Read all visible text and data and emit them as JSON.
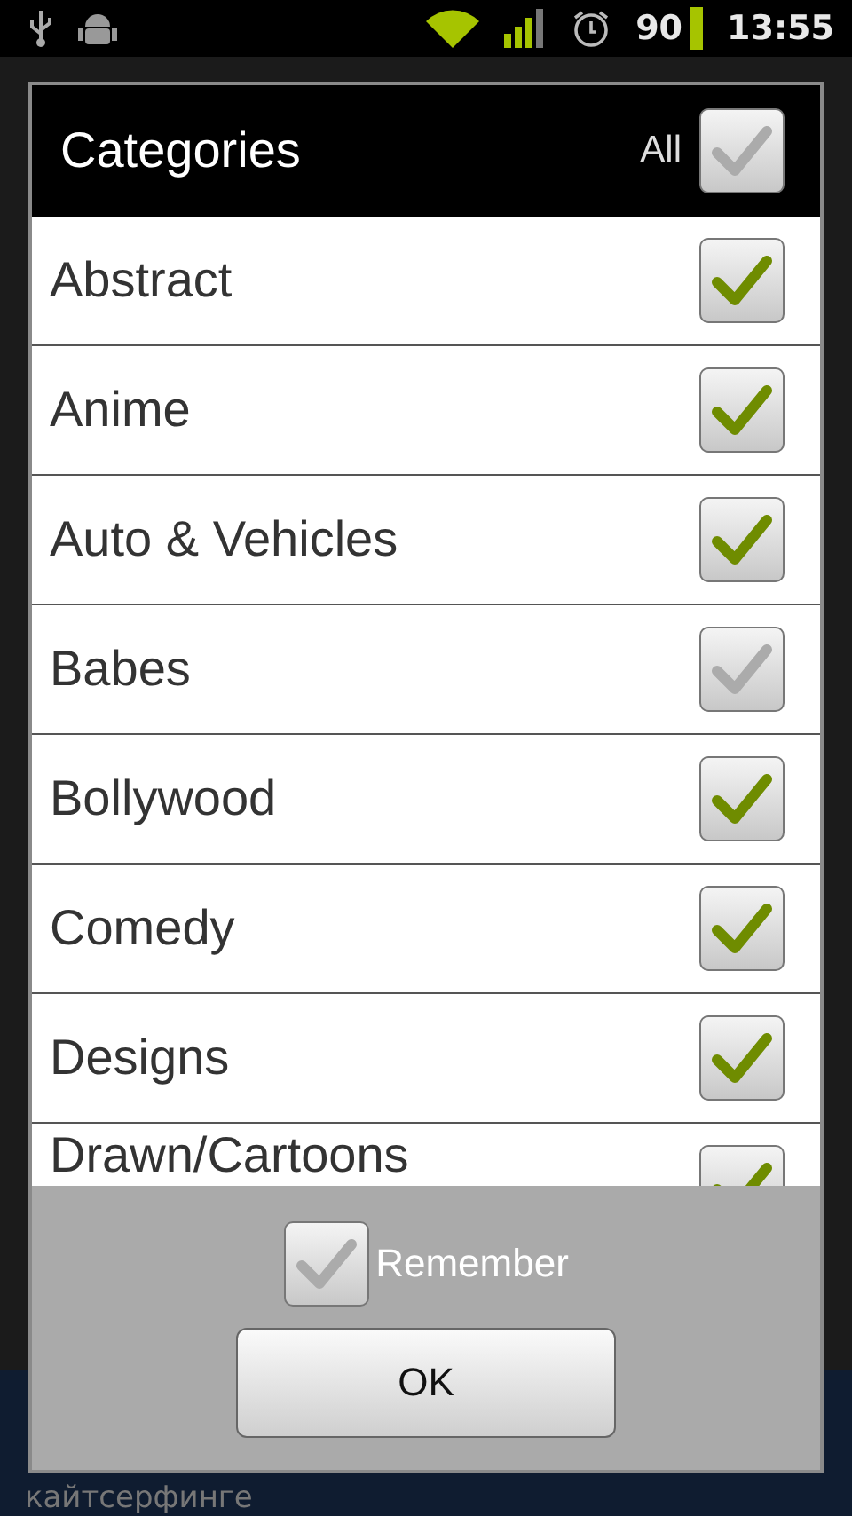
{
  "status_bar": {
    "battery_percent": "90",
    "time": "13:55"
  },
  "dialog": {
    "title": "Categories",
    "all_label": "All",
    "all_checked": false,
    "categories": [
      {
        "label": "Abstract",
        "checked": true
      },
      {
        "label": "Anime",
        "checked": true
      },
      {
        "label": "Auto & Vehicles",
        "checked": true
      },
      {
        "label": "Babes",
        "checked": false
      },
      {
        "label": "Bollywood",
        "checked": true
      },
      {
        "label": "Comedy",
        "checked": true
      },
      {
        "label": "Designs",
        "checked": true
      },
      {
        "label": "Drawn/Cartoons",
        "checked": true
      }
    ],
    "remember": {
      "label": "Remember",
      "checked": false
    },
    "ok_button": "OK"
  },
  "background_text": "кайтсерфинге"
}
